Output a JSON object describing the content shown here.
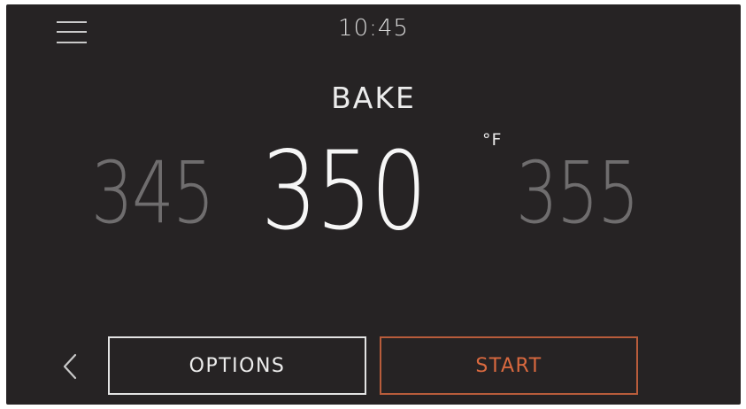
{
  "header": {
    "time": "10:45",
    "menu_icon": "hamburger-menu-icon"
  },
  "main": {
    "mode": "BAKE",
    "temperature": {
      "previous": "345",
      "current": "350",
      "next": "355",
      "unit": "°F"
    }
  },
  "footer": {
    "back_icon": "chevron-left-icon",
    "options_label": "OPTIONS",
    "start_label": "START"
  },
  "colors": {
    "background": "#262324",
    "accent": "#d9693f",
    "text": "#ececec",
    "inactive_text": "#6f6d6e"
  }
}
